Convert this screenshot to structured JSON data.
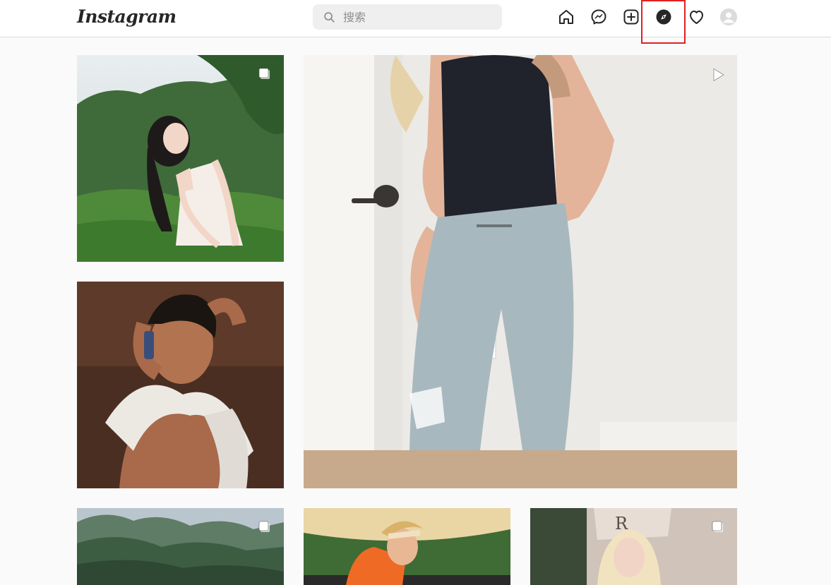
{
  "header": {
    "logo_text": "Instagram",
    "search": {
      "placeholder": "搜索",
      "value": ""
    },
    "nav": [
      {
        "name": "home-icon"
      },
      {
        "name": "messenger-icon"
      },
      {
        "name": "new-post-icon"
      },
      {
        "name": "explore-compass-icon",
        "highlighted": true
      },
      {
        "name": "activity-heart-icon"
      },
      {
        "name": "profile-avatar"
      }
    ]
  },
  "explore_grid": {
    "tiles": [
      {
        "name": "post-girl-white-dress",
        "badge": "carousel-icon"
      },
      {
        "name": "post-selfie-black-top-jeans",
        "badge": "reel-play-icon"
      },
      {
        "name": "post-man-towel-phone",
        "badge": ""
      },
      {
        "name": "post-mountains",
        "badge": "carousel-icon"
      },
      {
        "name": "post-woman-orange-umbrella",
        "badge": ""
      },
      {
        "name": "post-blonde-woman-cafe",
        "badge": "carousel-icon"
      }
    ]
  },
  "colors": {
    "highlight_box": "#e02020",
    "nav_icon": "#262626",
    "background": "#fafafa"
  }
}
